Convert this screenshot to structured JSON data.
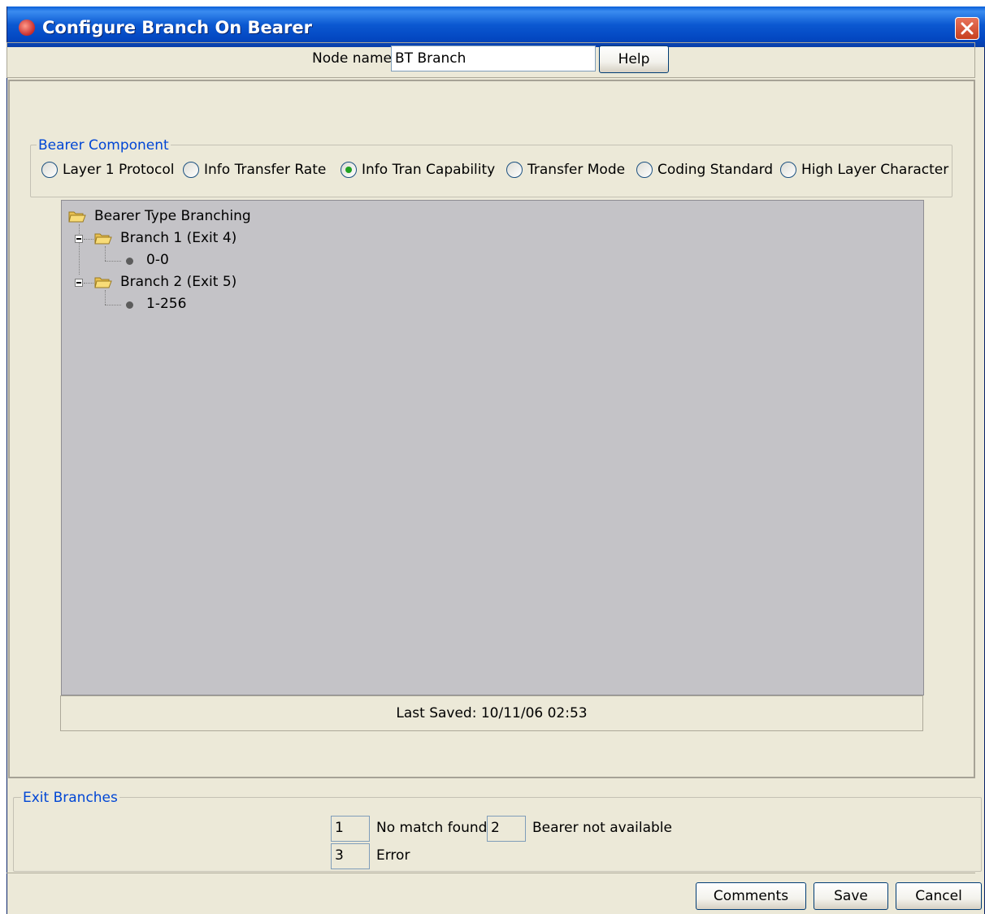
{
  "window": {
    "title": "Configure Branch On Bearer"
  },
  "header": {
    "node_name_label": "Node name",
    "node_name_value": "BT Branch",
    "help_label": "Help"
  },
  "bearer_component": {
    "legend": "Bearer Component",
    "options": [
      {
        "label": "Layer 1 Protocol",
        "selected": false
      },
      {
        "label": "Info Transfer Rate",
        "selected": false
      },
      {
        "label": "Info Tran Capability",
        "selected": true
      },
      {
        "label": "Transfer Mode",
        "selected": false
      },
      {
        "label": "Coding Standard",
        "selected": false
      },
      {
        "label": "High Layer Character",
        "selected": false
      }
    ]
  },
  "tree": {
    "root": "Bearer Type Branching",
    "branches": [
      {
        "label": "Branch 1 (Exit 4)",
        "leaf": "0-0"
      },
      {
        "label": "Branch 2 (Exit 5)",
        "leaf": "1-256"
      }
    ]
  },
  "status": {
    "last_saved": "Last Saved: 10/11/06 02:53"
  },
  "exit_branches": {
    "legend": "Exit Branches",
    "items": [
      {
        "number": "1",
        "label": "No match found"
      },
      {
        "number": "2",
        "label": "Bearer not available"
      },
      {
        "number": "3",
        "label": "Error"
      }
    ]
  },
  "footer": {
    "comments_label": "Comments",
    "save_label": "Save",
    "cancel_label": "Cancel"
  },
  "colors": {
    "title_bar": "#0a5fd8",
    "dialog_bg": "#ece9d8",
    "tree_bg": "#c4c3c7",
    "legend_text": "#0046d5",
    "radio_selected": "#21a121"
  }
}
